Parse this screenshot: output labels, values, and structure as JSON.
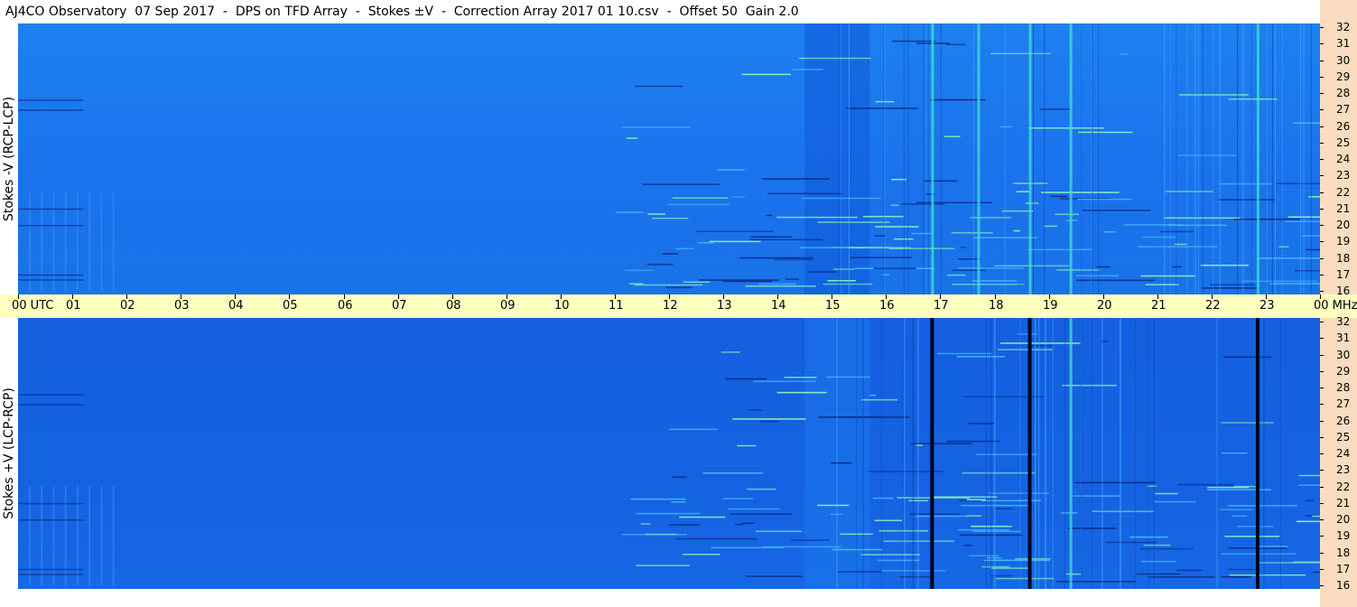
{
  "title": "AJ4CO Observatory  07 Sep 2017  -  DPS on TFD Array  -  Stokes ±V  -  Correction Array 2017 01 10.csv  -  Offset 50  Gain 2.0",
  "time_axis": {
    "labels": [
      "00 UTC",
      "01",
      "02",
      "03",
      "04",
      "05",
      "06",
      "07",
      "08",
      "09",
      "10",
      "11",
      "12",
      "13",
      "14",
      "15",
      "16",
      "17",
      "18",
      "19",
      "20",
      "21",
      "22",
      "23",
      "00 MHz"
    ]
  },
  "freq_axis": {
    "labels": [
      "32",
      "31",
      "30",
      "29",
      "28",
      "27",
      "26",
      "25",
      "24",
      "23",
      "22",
      "21",
      "20",
      "19",
      "18",
      "17",
      "16"
    ]
  },
  "chart_data": [
    {
      "type": "heatmap",
      "title": "",
      "ylabel": "Stokes -V (RCP-LCP)",
      "xlabel": "UTC",
      "xlim": [
        0,
        24
      ],
      "ylim": [
        16,
        32
      ],
      "colormap": "blue",
      "features": {
        "bright_vertical_hours": [
          16.85,
          17.7,
          18.65,
          19.4,
          22.85
        ],
        "dark_vertical_hours": [],
        "horizontal_bands_mhz": [
          16.7,
          17.0,
          20.0,
          21.0,
          27.0,
          27.6
        ]
      }
    },
    {
      "type": "heatmap",
      "title": "",
      "ylabel": "Stokes +V (LCP-RCP)",
      "xlabel": "UTC",
      "xlim": [
        0,
        24
      ],
      "ylim": [
        16,
        32
      ],
      "colormap": "blue",
      "features": {
        "bright_vertical_hours": [
          19.4
        ],
        "dark_vertical_hours": [
          16.85,
          18.65,
          22.85
        ],
        "horizontal_bands_mhz": [
          16.7,
          17.0,
          20.0,
          21.0,
          27.0,
          27.6
        ]
      }
    }
  ],
  "colors": {
    "background_top": "#1a78ee",
    "background_bottom": "#1562e2",
    "time_bar": "#ffffc0",
    "freq_strip": "#fbdcc0",
    "bright_line": "#3ee6d0",
    "dark_line": "#000020"
  }
}
